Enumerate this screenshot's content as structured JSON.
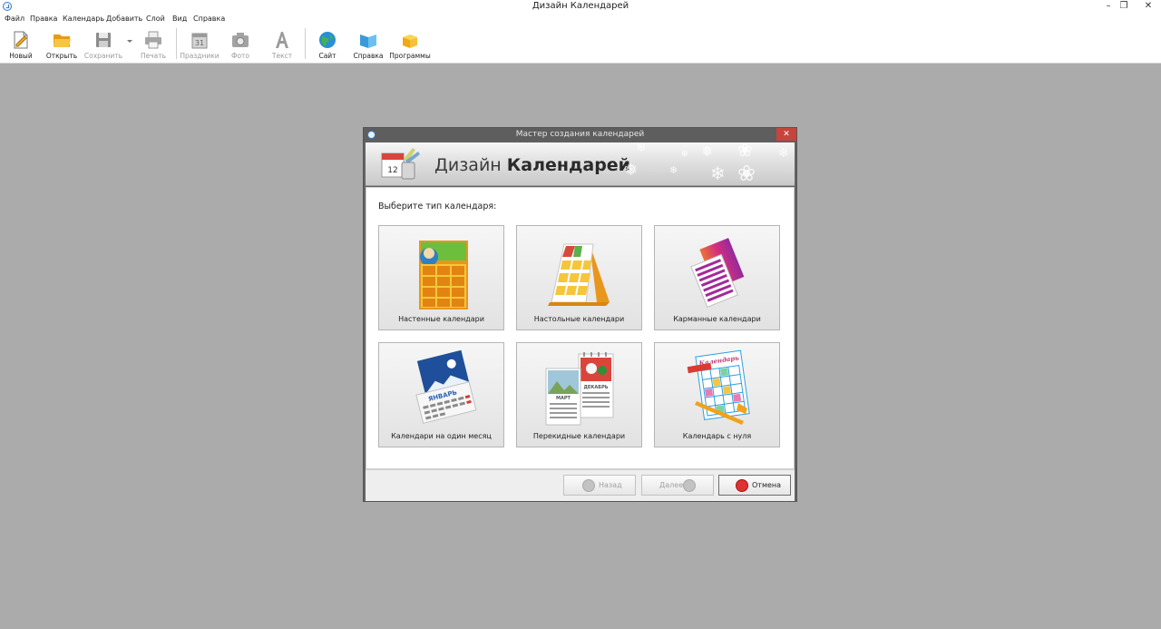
{
  "window": {
    "title": "Дизайн Календарей"
  },
  "menu": [
    "Файл",
    "Правка",
    "Календарь",
    "Добавить",
    "Слой",
    "Вид",
    "Справка"
  ],
  "toolbar": {
    "new_label": "Новый",
    "open_label": "Открыть",
    "save_label": "Сохранить",
    "print_label": "Печать",
    "holidays_label": "Праздники",
    "photo_label": "Фото",
    "text_label": "Текст",
    "site_label": "Сайт",
    "help_label": "Справка",
    "programs_label": "Программы"
  },
  "dialog": {
    "title": "Мастер создания календарей",
    "banner_regular": "Дизайн ",
    "banner_bold": "Календарей",
    "prompt": "Выберите тип календаря:",
    "cards": [
      {
        "label": "Настенные календари",
        "icon": "wall-calendar-icon"
      },
      {
        "label": "Настольные календари",
        "icon": "desk-calendar-icon"
      },
      {
        "label": "Карманные календари",
        "icon": "pocket-calendar-icon"
      },
      {
        "label": "Календари на один месяц",
        "icon": "monthly-calendar-icon"
      },
      {
        "label": "Перекидные календари",
        "icon": "flip-calendar-icon"
      },
      {
        "label": "Календарь с нуля",
        "icon": "blank-calendar-icon"
      }
    ],
    "art_text": {
      "monthly": "ЯНВАРЬ",
      "flip_a": "ДЕКАБРЬ",
      "flip_b": "МАРТ",
      "blank": "Календарь",
      "banner_day": "12"
    },
    "buttons": {
      "back": "Назад",
      "next": "Далее",
      "cancel": "Отмена"
    }
  },
  "colors": {
    "workspace": "#ababab",
    "close_red": "#c7443c",
    "accent_orange": "#f2a21a"
  }
}
